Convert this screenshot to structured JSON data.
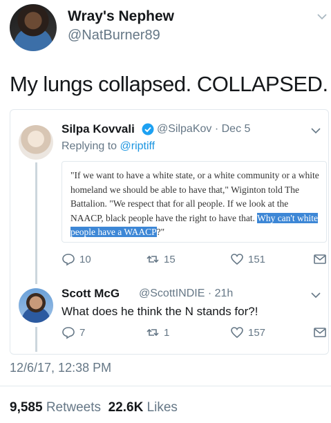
{
  "author": {
    "display_name": "Wray's Nephew",
    "handle": "@NatBurner89",
    "avatar": "avatar"
  },
  "tweet": {
    "text": "My lungs collapsed. COLLAPSED.",
    "timestamp": "12/6/17, 12:38 PM",
    "retweets_count": "9,585",
    "retweets_label": "Retweets",
    "likes_count": "22.6K",
    "likes_label": "Likes"
  },
  "thread": {
    "reply1": {
      "display_name": "Silpa Kovvali",
      "verified": true,
      "handle": "@SilpaKov",
      "separator": "·",
      "date": "Dec 5",
      "replying_to_label": "Replying to",
      "replying_to_handle": "@riptiff",
      "article_text_plain": "\"If we want to have a white state, or a white community or a white homeland we should be able to have that,\" Wiginton told The Battalion. \"We respect that for all people. If we look at the NAACP, black people have the right to have that. ",
      "article_text_highlight": "Why can't white people have a WAACP",
      "article_text_end": "?\"",
      "replies": "10",
      "retweets": "15",
      "likes": "151"
    },
    "reply2": {
      "display_name": "Scott McG",
      "handle": "@ScottINDIE",
      "separator": "·",
      "date": "21h",
      "text": "What does he think the N stands for?!",
      "replies": "7",
      "retweets": "1",
      "likes": "157"
    }
  },
  "icons": {
    "reply": "reply-icon",
    "retweet": "retweet-icon",
    "like": "heart-icon",
    "dm": "envelope-icon",
    "more": "chevron-down-icon",
    "verified": "verified-badge-icon"
  },
  "colors": {
    "link": "#1b95e0",
    "muted": "#657786",
    "text": "#14171a",
    "highlight": "#3d87d6"
  }
}
